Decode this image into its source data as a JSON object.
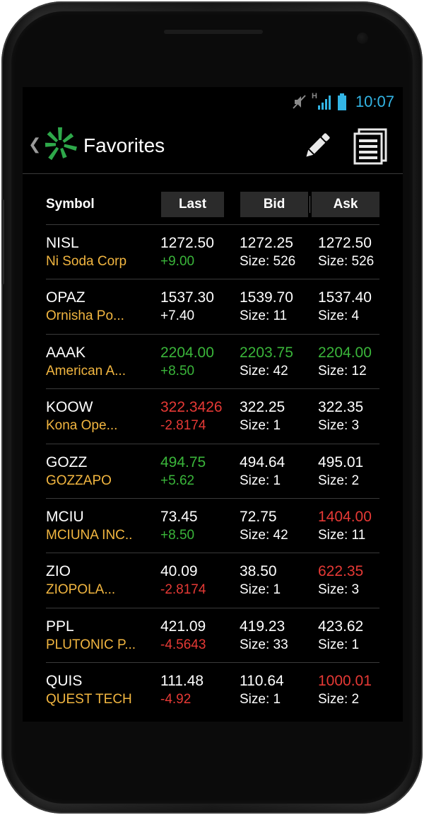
{
  "status_bar": {
    "time": "10:07",
    "network_label": "H",
    "icons": [
      "mute-icon",
      "signal-icon",
      "battery-icon"
    ]
  },
  "action_bar": {
    "title": "Favorites",
    "icons": [
      "back-chevron-icon",
      "app-logo-icon",
      "pencil-icon",
      "list-icon"
    ]
  },
  "columns": {
    "symbol": "Symbol",
    "last": "Last",
    "bid": "Bid",
    "ask": "Ask"
  },
  "colors": {
    "up": "#3ab53a",
    "down": "#e53935",
    "name": "#f2b640",
    "time": "#33b5e5"
  },
  "quotes": [
    {
      "symbol": "NISL",
      "name": "Ni Soda Corp",
      "last": "1272.50",
      "last_color": "white",
      "change": "+9.00",
      "change_color": "green",
      "bid": "1272.25",
      "bid_color": "white",
      "bid_size": "Size: 526",
      "ask": "1272.50",
      "ask_color": "white",
      "ask_size": "Size: 526"
    },
    {
      "symbol": "OPAZ",
      "name": "Ornisha Po...",
      "last": "1537.30",
      "last_color": "white",
      "change": "+7.40",
      "change_color": "white",
      "bid": "1539.70",
      "bid_color": "white",
      "bid_size": "Size: 11",
      "ask": "1537.40",
      "ask_color": "white",
      "ask_size": "Size: 4"
    },
    {
      "symbol": "AAAK",
      "name": "American A...",
      "last": "2204.00",
      "last_color": "green",
      "change": "+8.50",
      "change_color": "green",
      "bid": "2203.75",
      "bid_color": "green",
      "bid_size": "Size: 42",
      "ask": "2204.00",
      "ask_color": "green",
      "ask_size": "Size: 12"
    },
    {
      "symbol": "KOOW",
      "name": "Kona Ope...",
      "last": "322.3426",
      "last_color": "red",
      "change": "-2.8174",
      "change_color": "red",
      "bid": "322.25",
      "bid_color": "white",
      "bid_size": "Size: 1",
      "ask": "322.35",
      "ask_color": "white",
      "ask_size": "Size: 3"
    },
    {
      "symbol": "GOZZ",
      "name": "GOZZAPO",
      "last": "494.75",
      "last_color": "green",
      "change": "+5.62",
      "change_color": "green",
      "bid": "494.64",
      "bid_color": "white",
      "bid_size": "Size: 1",
      "ask": "495.01",
      "ask_color": "white",
      "ask_size": "Size: 2"
    },
    {
      "symbol": "MCIU",
      "name": "MCIUNA INC..",
      "last": "73.45",
      "last_color": "white",
      "change": "+8.50",
      "change_color": "green",
      "bid": "72.75",
      "bid_color": "white",
      "bid_size": "Size: 42",
      "ask": "1404.00",
      "ask_color": "red",
      "ask_size": "Size: 11"
    },
    {
      "symbol": "ZIO",
      "name": "ZIOPOLA...",
      "last": "40.09",
      "last_color": "white",
      "change": "-2.8174",
      "change_color": "red",
      "bid": "38.50",
      "bid_color": "white",
      "bid_size": "Size: 1",
      "ask": "622.35",
      "ask_color": "red",
      "ask_size": "Size: 3"
    },
    {
      "symbol": "PPL",
      "name": "PLUTONIC P...",
      "last": "421.09",
      "last_color": "white",
      "change": "-4.5643",
      "change_color": "red",
      "bid": "419.23",
      "bid_color": "white",
      "bid_size": "Size: 33",
      "ask": "423.62",
      "ask_color": "white",
      "ask_size": "Size: 1"
    },
    {
      "symbol": "QUIS",
      "name": "QUEST TECH",
      "last": "111.48",
      "last_color": "white",
      "change": "-4.92",
      "change_color": "red",
      "bid": "110.64",
      "bid_color": "white",
      "bid_size": "Size: 1",
      "ask": "1000.01",
      "ask_color": "red",
      "ask_size": "Size: 2"
    }
  ]
}
